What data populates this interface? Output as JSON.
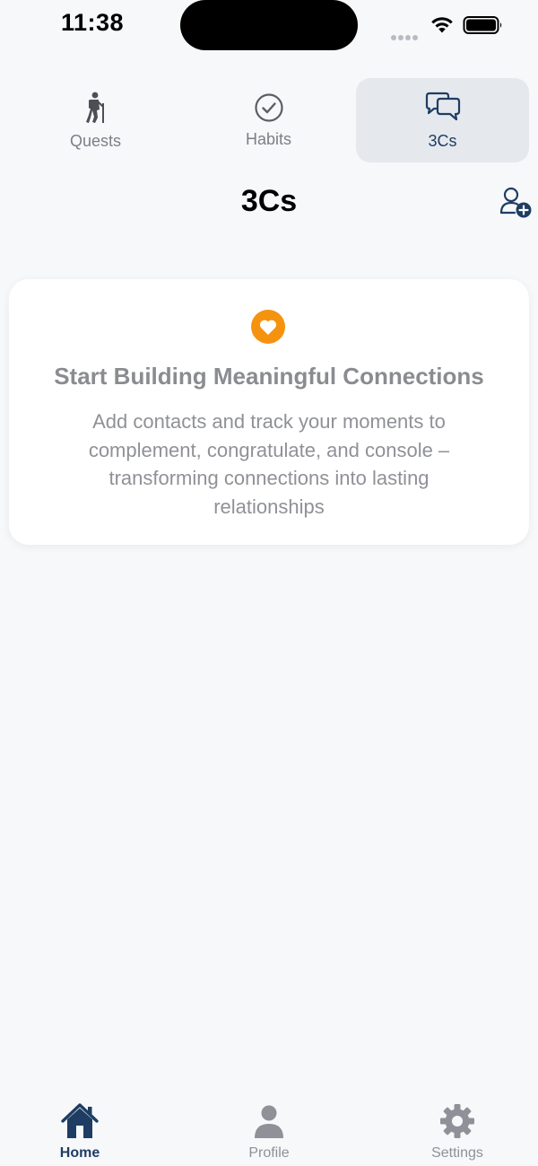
{
  "status_bar": {
    "time": "11:38"
  },
  "top_tabs": [
    {
      "label": "Quests",
      "icon": "hiker-icon",
      "active": false
    },
    {
      "label": "Habits",
      "icon": "checkmark-circle-icon",
      "active": false
    },
    {
      "label": "3Cs",
      "icon": "chat-bubbles-icon",
      "active": true
    }
  ],
  "header": {
    "title": "3Cs",
    "action_icon": "add-contact-icon"
  },
  "empty_state": {
    "icon": "heart-icon",
    "title": "Start Building Meaningful Connections",
    "description": "Add contacts and track your moments to complement, congratulate, and console – transforming connections into lasting relationships"
  },
  "bottom_nav": [
    {
      "label": "Home",
      "icon": "home-icon",
      "active": true
    },
    {
      "label": "Profile",
      "icon": "person-icon",
      "active": false
    },
    {
      "label": "Settings",
      "icon": "gear-icon",
      "active": false
    }
  ],
  "colors": {
    "background": "#f6f8fa",
    "accent": "#1f3d63",
    "heart": "#f5930f",
    "inactive": "#8e9197",
    "active_tab_bg": "#e5e9ee"
  }
}
